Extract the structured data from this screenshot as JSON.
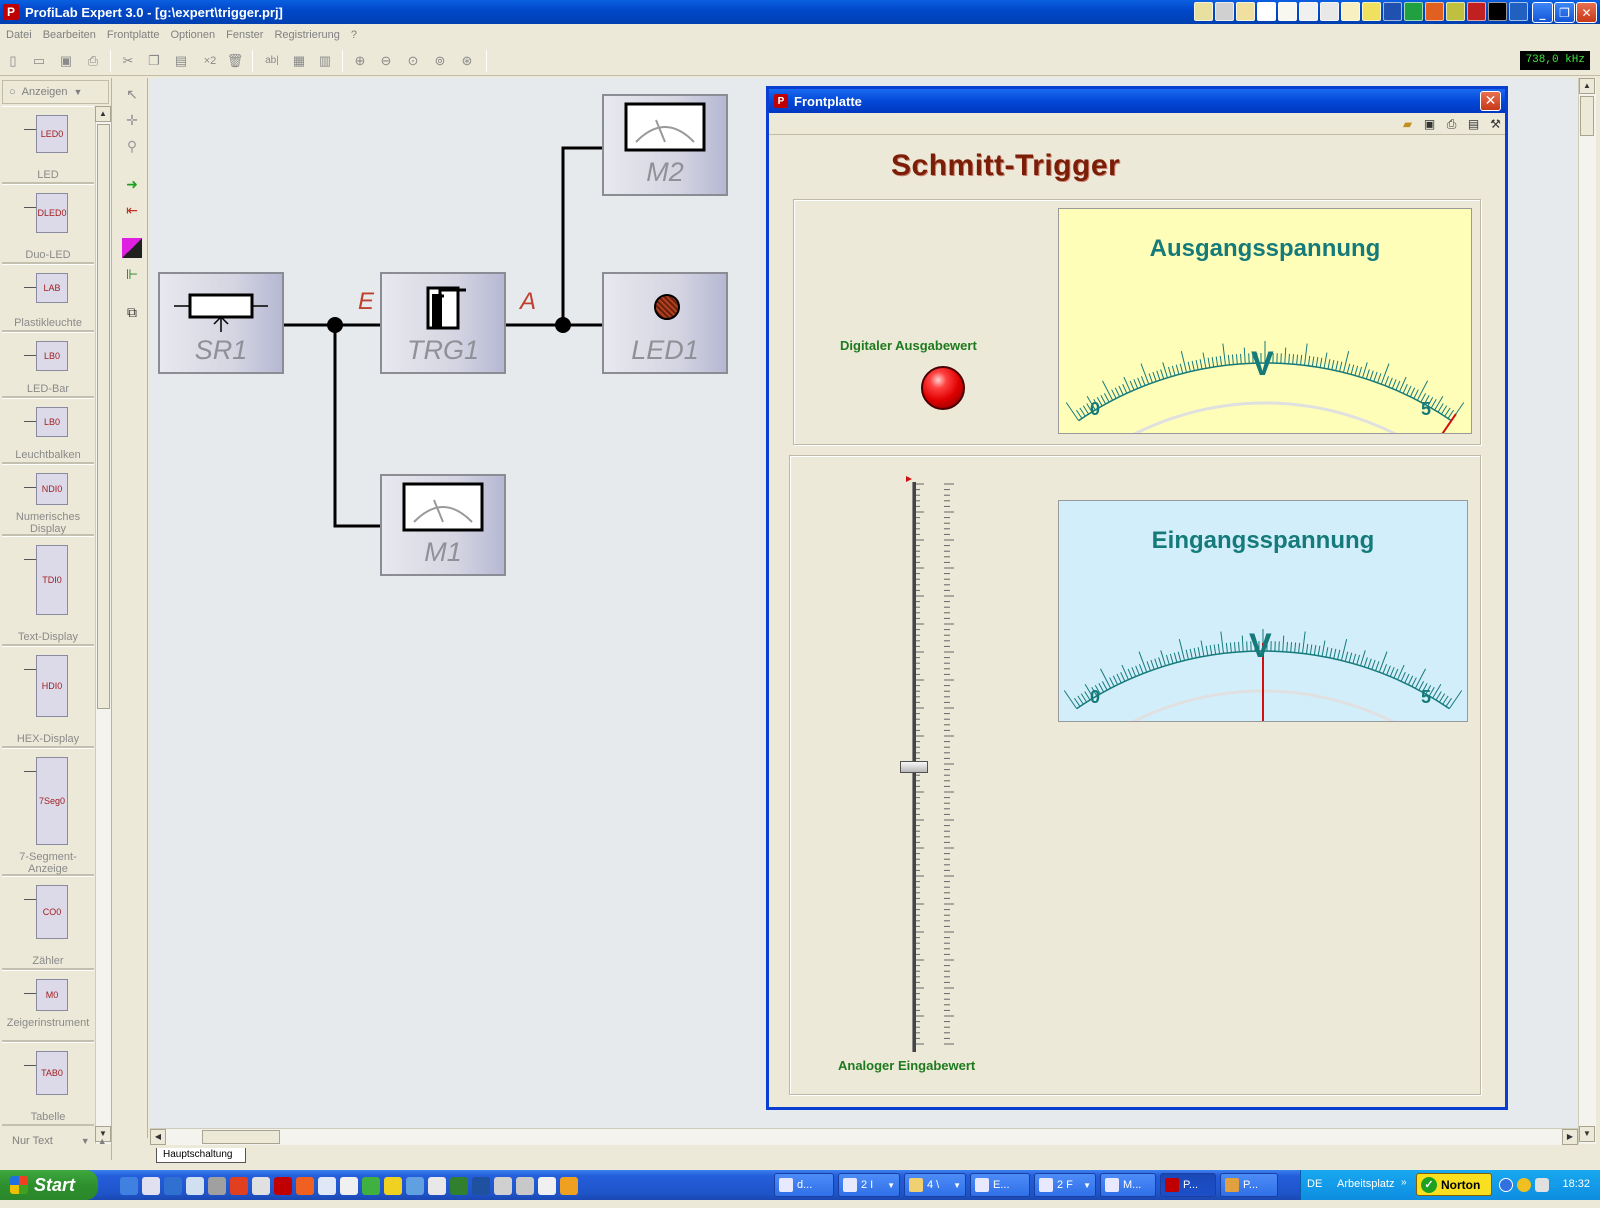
{
  "window": {
    "title": "ProfiLab Expert 3.0 - [g:\\expert\\trigger.prj]",
    "icon": "profilab-icon"
  },
  "menu": [
    "Datei",
    "Bearbeiten",
    "Frontplatte",
    "Optionen",
    "Fenster",
    "Registrierung",
    "?"
  ],
  "toolbar": {
    "buttons": [
      "new-icon",
      "open-icon",
      "save-icon",
      "print-icon",
      "cut-icon",
      "copy-icon",
      "paste-icon",
      "duplicate-icon",
      "delete-icon",
      "text-icon",
      "grid-icon",
      "list-icon",
      "zoom-in-icon",
      "zoom-out-icon",
      "zoom-fit-icon",
      "zoom-page-icon",
      "zoom-all-icon"
    ],
    "duplicate_label": "×2",
    "text_label": "ab|",
    "frequency": "738,0 kHz"
  },
  "palette": {
    "category": "Anzeigen",
    "items": [
      {
        "label": "LED",
        "icon_text": "LED0"
      },
      {
        "label": "Duo-LED",
        "icon_text": "DLED0"
      },
      {
        "label": "Plastikleuchte",
        "icon_text": "LAB"
      },
      {
        "label": "LED-Bar",
        "icon_text": "LB0"
      },
      {
        "label": "Leuchtbalken",
        "icon_text": "LB0"
      },
      {
        "label": "Numerisches Display",
        "icon_text": "NDI0"
      },
      {
        "label": "Text-Display",
        "icon_text": "TDI0"
      },
      {
        "label": "HEX-Display",
        "icon_text": "HDI0"
      },
      {
        "label": "7-Segment-Anzeige",
        "icon_text": "7Seg0"
      },
      {
        "label": "Zähler",
        "icon_text": "CO0"
      },
      {
        "label": "Zeigerinstrument",
        "icon_text": "M0"
      },
      {
        "label": "Tabelle",
        "icon_text": "TAB0"
      }
    ],
    "footer": "Nur Text"
  },
  "schematic": {
    "blocks": {
      "sr1": "SR1",
      "trg1": "TRG1",
      "led1": "LED1",
      "m1": "M1",
      "m2": "M2"
    },
    "labels": {
      "input": "E",
      "output": "A"
    },
    "sheet_tab": "Hauptschaltung"
  },
  "frontpanel": {
    "title": "Frontplatte",
    "heading": "Schmitt-Trigger",
    "led_caption": "Digitaler Ausgabewert",
    "slider_caption": "Analoger Eingabewert",
    "slider_value_fraction": 0.49,
    "gauge_out": {
      "title": "Ausgangsspannung",
      "unit": "V",
      "min": "0",
      "max": "5",
      "value": 5,
      "bg": "#fffeb8"
    },
    "gauge_in": {
      "title": "Eingangsspannung",
      "unit": "V",
      "min": "0",
      "max": "5",
      "value": 2.5,
      "bg": "#d2eefb"
    }
  },
  "taskbar": {
    "start": "Start",
    "tasks": [
      "d...",
      "2 I",
      "4 \\",
      "E...",
      "2 F",
      "M...",
      "P...",
      "P..."
    ],
    "language": "DE",
    "desktop": "Arbeitsplatz",
    "norton": "Norton",
    "clock": "18:32"
  },
  "colors": {
    "accent": "#0a3ed0",
    "needle": "#d01010",
    "gauge_text": "#157a7a",
    "caption_green": "#1e7a1e",
    "heading": "#7a1e08"
  }
}
